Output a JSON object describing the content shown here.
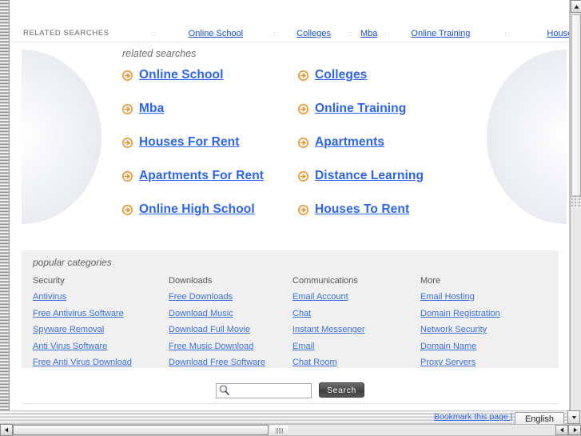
{
  "topnav": {
    "label": "RELATED SEARCHES",
    "separator": "::",
    "links": [
      "Online School",
      "Colleges",
      "Mba",
      "Online Training",
      "Houses For Rent"
    ]
  },
  "related": {
    "heading": "related searches",
    "icon": "arrow-circle-right-icon",
    "items": [
      "Online School",
      "Colleges",
      "Mba",
      "Online Training",
      "Houses For Rent",
      "Apartments",
      "Apartments For Rent",
      "Distance Learning",
      "Online High School",
      "Houses To Rent"
    ]
  },
  "popular": {
    "heading": "popular categories",
    "columns": [
      {
        "title": "Security",
        "links": [
          "Antivirus",
          "Free Antivirus Software",
          "Spyware Removal",
          "Anti Virus Software",
          "Free Anti Virus Download"
        ]
      },
      {
        "title": "Downloads",
        "links": [
          "Free Downloads",
          "Download Music",
          "Download Full Movie",
          "Free Music Download",
          "Download Free Software"
        ]
      },
      {
        "title": "Communications",
        "links": [
          "Email Account",
          "Chat",
          "Instant Messenger",
          "Email",
          "Chat Room"
        ]
      },
      {
        "title": "More",
        "links": [
          "Email Hosting",
          "Domain Registration",
          "Network Security",
          "Domain Name",
          "Proxy Servers"
        ]
      }
    ]
  },
  "search": {
    "icon": "magnifier-icon",
    "value": "",
    "placeholder": "",
    "button_label": "Search"
  },
  "footer": {
    "bookmark_label": "Bookmark this page |",
    "language": "English",
    "dropdown_icon": "chevron-down-icon"
  },
  "scrollbars": {
    "up_icon": "scroll-up-arrow-icon",
    "left_icon": "scroll-left-arrow-icon",
    "right_icon": "scroll-right-arrow-icon"
  },
  "colors": {
    "link_blue": "#2a64f0",
    "topnav_blue": "#1a4fd6",
    "category_blue": "#3a6fe0",
    "arrow_orange": "#f08c1e",
    "panel_gray": "#f0f0f0"
  }
}
